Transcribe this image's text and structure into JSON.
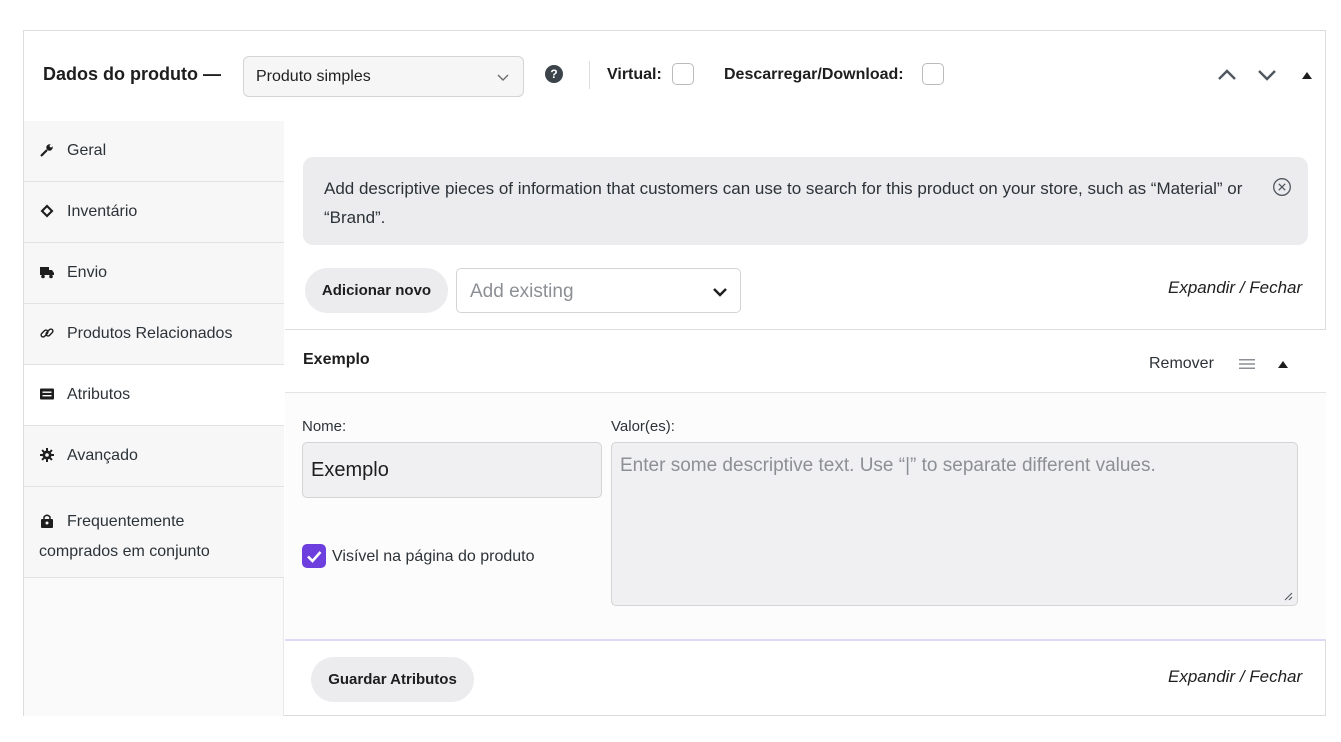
{
  "header": {
    "title": "Dados do produto —",
    "product_type": "Produto simples",
    "help_icon": "question-circle-icon",
    "virtual_label": "Virtual:",
    "download_label": "Descarregar/Download:"
  },
  "sidebar": {
    "items": [
      {
        "label": "Geral",
        "icon": "wrench-icon"
      },
      {
        "label": "Inventário",
        "icon": "tag-icon"
      },
      {
        "label": "Envio",
        "icon": "truck-icon"
      },
      {
        "label": "Produtos Relacionados",
        "icon": "link-icon"
      },
      {
        "label": "Atributos",
        "icon": "list-icon"
      },
      {
        "label": "Avançado",
        "icon": "gear-icon"
      },
      {
        "label1": "Frequentemente",
        "label2": "comprados em conjunto",
        "icon": "bag-icon"
      }
    ]
  },
  "notice": {
    "text": "Add descriptive pieces of information that customers can use to search for this product on your store, such as “Material” or “Brand”."
  },
  "toolbar": {
    "add_new": "Adicionar novo",
    "add_existing_placeholder": "Add existing",
    "expand_collapse": "Expandir / Fechar"
  },
  "attribute": {
    "name": "Exemplo",
    "remove_label": "Remover",
    "name_label": "Nome:",
    "name_value": "Exemplo",
    "values_label": "Valor(es):",
    "values_placeholder": "Enter some descriptive text. Use “|” to separate different values.",
    "visible_label": "Visível na página do produto",
    "visible_checked": true
  },
  "footer": {
    "save_label": "Guardar Atributos",
    "expand_collapse": "Expandir / Fechar"
  },
  "colors": {
    "accent": "#6d3fde",
    "text": "#1e1e1e",
    "notice_bg": "#ececee"
  }
}
